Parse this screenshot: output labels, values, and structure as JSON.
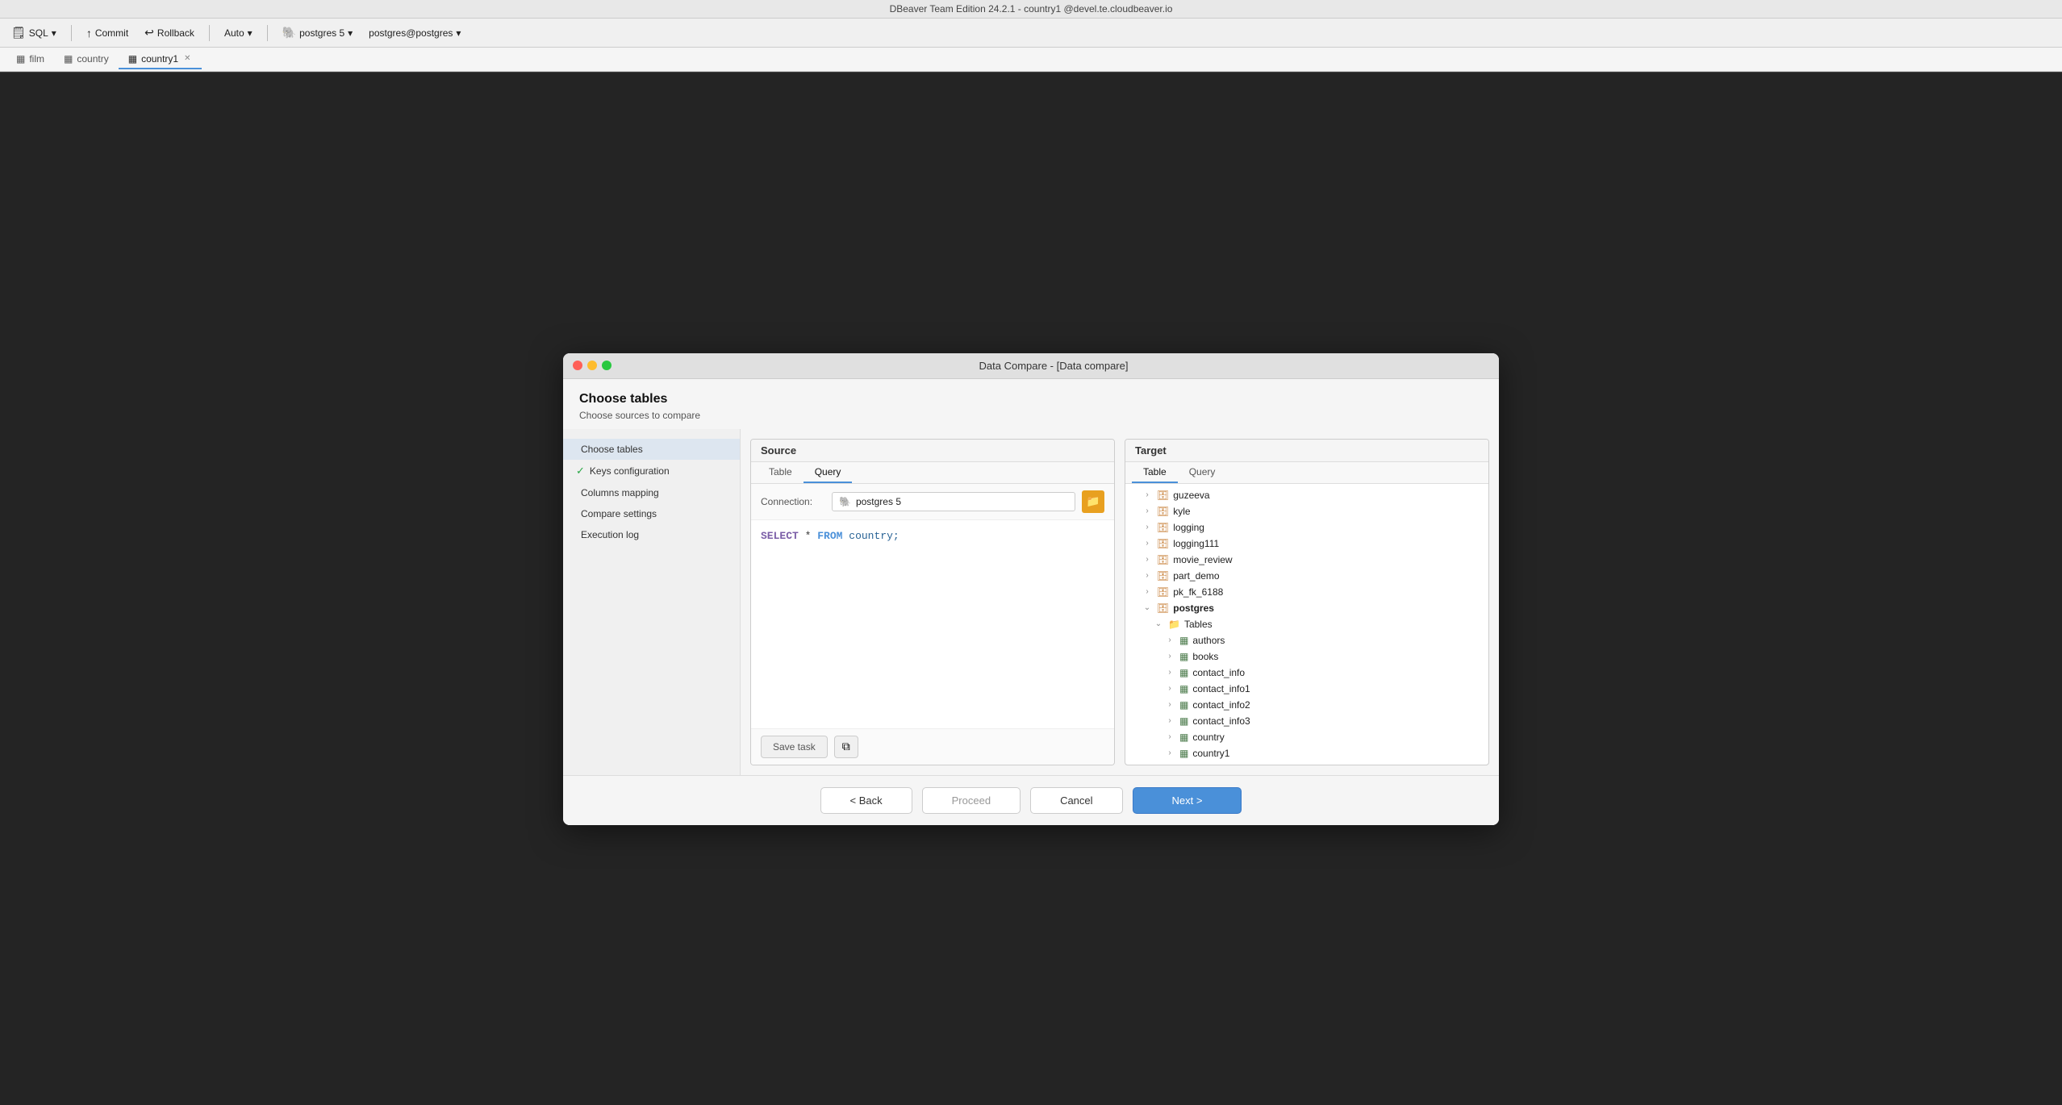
{
  "app": {
    "title": "DBeaver Team Edition 24.2.1 - country1 @devel.te.cloudbeaver.io",
    "toolbar": {
      "sql_label": "SQL",
      "commit_label": "Commit",
      "rollback_label": "Rollback",
      "auto_label": "Auto",
      "connection_label": "postgres 5",
      "user_label": "postgres@postgres"
    },
    "tabs": [
      {
        "id": "film",
        "label": "film",
        "active": false,
        "closeable": false
      },
      {
        "id": "country",
        "label": "country",
        "active": false,
        "closeable": false
      },
      {
        "id": "country1",
        "label": "country1",
        "active": true,
        "closeable": true
      }
    ]
  },
  "dialog": {
    "title": "Data Compare - [Data compare]",
    "wizard_title": "Choose tables",
    "wizard_subtitle": "Choose sources to compare",
    "traffic_lights": [
      "red",
      "yellow",
      "green"
    ],
    "sidebar": {
      "steps": [
        {
          "id": "choose-tables",
          "label": "Choose tables",
          "state": "active",
          "check": ""
        },
        {
          "id": "keys-config",
          "label": "Keys configuration",
          "state": "completed",
          "check": "✓"
        },
        {
          "id": "columns-mapping",
          "label": "Columns mapping",
          "state": "normal",
          "check": ""
        },
        {
          "id": "compare-settings",
          "label": "Compare settings",
          "state": "normal",
          "check": ""
        },
        {
          "id": "execution-log",
          "label": "Execution log",
          "state": "normal",
          "check": ""
        }
      ]
    },
    "source": {
      "panel_title": "Source",
      "tabs": [
        "Table",
        "Query"
      ],
      "active_tab": "Query",
      "connection_label": "Connection:",
      "connection_value": "postgres 5",
      "query": "SELECT * FROM country;"
    },
    "target": {
      "panel_title": "Target",
      "tabs": [
        "Table",
        "Query"
      ],
      "active_tab": "Table",
      "tree": [
        {
          "id": "guzeeva",
          "label": "guzeeva",
          "level": 1,
          "type": "db",
          "expanded": false
        },
        {
          "id": "kyle",
          "label": "kyle",
          "level": 1,
          "type": "db",
          "expanded": false
        },
        {
          "id": "logging",
          "label": "logging",
          "level": 1,
          "type": "db",
          "expanded": false
        },
        {
          "id": "logging111",
          "label": "logging111",
          "level": 1,
          "type": "db",
          "expanded": false
        },
        {
          "id": "movie_review",
          "label": "movie_review",
          "level": 1,
          "type": "db",
          "expanded": false
        },
        {
          "id": "part_demo",
          "label": "part_demo",
          "level": 1,
          "type": "db",
          "expanded": false
        },
        {
          "id": "pk_fk_6188",
          "label": "pk_fk_6188",
          "level": 1,
          "type": "db",
          "expanded": false
        },
        {
          "id": "postgres",
          "label": "postgres",
          "level": 1,
          "type": "db",
          "expanded": true,
          "bold": true
        },
        {
          "id": "tables-group",
          "label": "Tables",
          "level": 2,
          "type": "folder",
          "expanded": true
        },
        {
          "id": "authors",
          "label": "authors",
          "level": 3,
          "type": "table"
        },
        {
          "id": "books",
          "label": "books",
          "level": 3,
          "type": "table"
        },
        {
          "id": "contact_info",
          "label": "contact_info",
          "level": 3,
          "type": "table"
        },
        {
          "id": "contact_info1",
          "label": "contact_info1",
          "level": 3,
          "type": "table"
        },
        {
          "id": "contact_info2",
          "label": "contact_info2",
          "level": 3,
          "type": "table"
        },
        {
          "id": "contact_info3",
          "label": "contact_info3",
          "level": 3,
          "type": "table"
        },
        {
          "id": "country",
          "label": "country",
          "level": 3,
          "type": "table"
        },
        {
          "id": "country1",
          "label": "country1",
          "level": 3,
          "type": "table"
        }
      ]
    },
    "footer": {
      "back_label": "< Back",
      "proceed_label": "Proceed",
      "cancel_label": "Cancel",
      "next_label": "Next >"
    },
    "save_task_label": "Save task"
  }
}
